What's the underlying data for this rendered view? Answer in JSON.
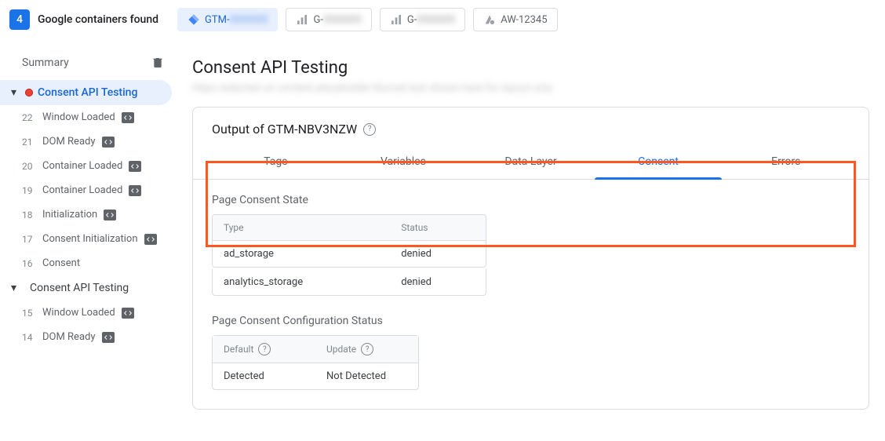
{
  "topbar": {
    "count": "4",
    "label": "Google containers found",
    "containers": [
      {
        "id": "GTM-",
        "active": true,
        "icon": "gtm"
      },
      {
        "id": "G-",
        "active": false,
        "icon": "ga"
      },
      {
        "id": "G-",
        "active": false,
        "icon": "ga"
      },
      {
        "id": "AW-12345",
        "active": false,
        "icon": "ads"
      }
    ]
  },
  "sidebar": {
    "summary_label": "Summary",
    "groups": [
      {
        "header": "Consent API Testing",
        "selected": true,
        "items": [
          {
            "num": "22",
            "label": "Window Loaded",
            "badge": true
          },
          {
            "num": "21",
            "label": "DOM Ready",
            "badge": true
          },
          {
            "num": "20",
            "label": "Container Loaded",
            "badge": true
          },
          {
            "num": "19",
            "label": "Container Loaded",
            "badge": true
          },
          {
            "num": "18",
            "label": "Initialization",
            "badge": true
          },
          {
            "num": "17",
            "label": "Consent Initialization",
            "badge": true
          },
          {
            "num": "16",
            "label": "Consent",
            "badge": false
          }
        ]
      },
      {
        "header": "Consent API Testing",
        "selected": false,
        "items": [
          {
            "num": "15",
            "label": "Window Loaded",
            "badge": true
          },
          {
            "num": "14",
            "label": "DOM Ready",
            "badge": true
          }
        ]
      }
    ]
  },
  "main": {
    "title": "Consent API Testing",
    "url_placeholder": "https redacted url content placeholder blurred text shown here for layout only",
    "card_title": "Output of GTM-NBV3NZW",
    "tabs": [
      "Tags",
      "Variables",
      "Data Layer",
      "Consent",
      "Errors"
    ],
    "active_tab": 3,
    "consent_state": {
      "title": "Page Consent State",
      "head": [
        "Type",
        "Status"
      ],
      "rows": [
        {
          "type": "ad_storage",
          "status": "denied"
        },
        {
          "type": "analytics_storage",
          "status": "denied"
        }
      ]
    },
    "config_status": {
      "title": "Page Consent Configuration Status",
      "head": [
        "Default",
        "Update"
      ],
      "row": [
        "Detected",
        "Not Detected"
      ]
    }
  }
}
